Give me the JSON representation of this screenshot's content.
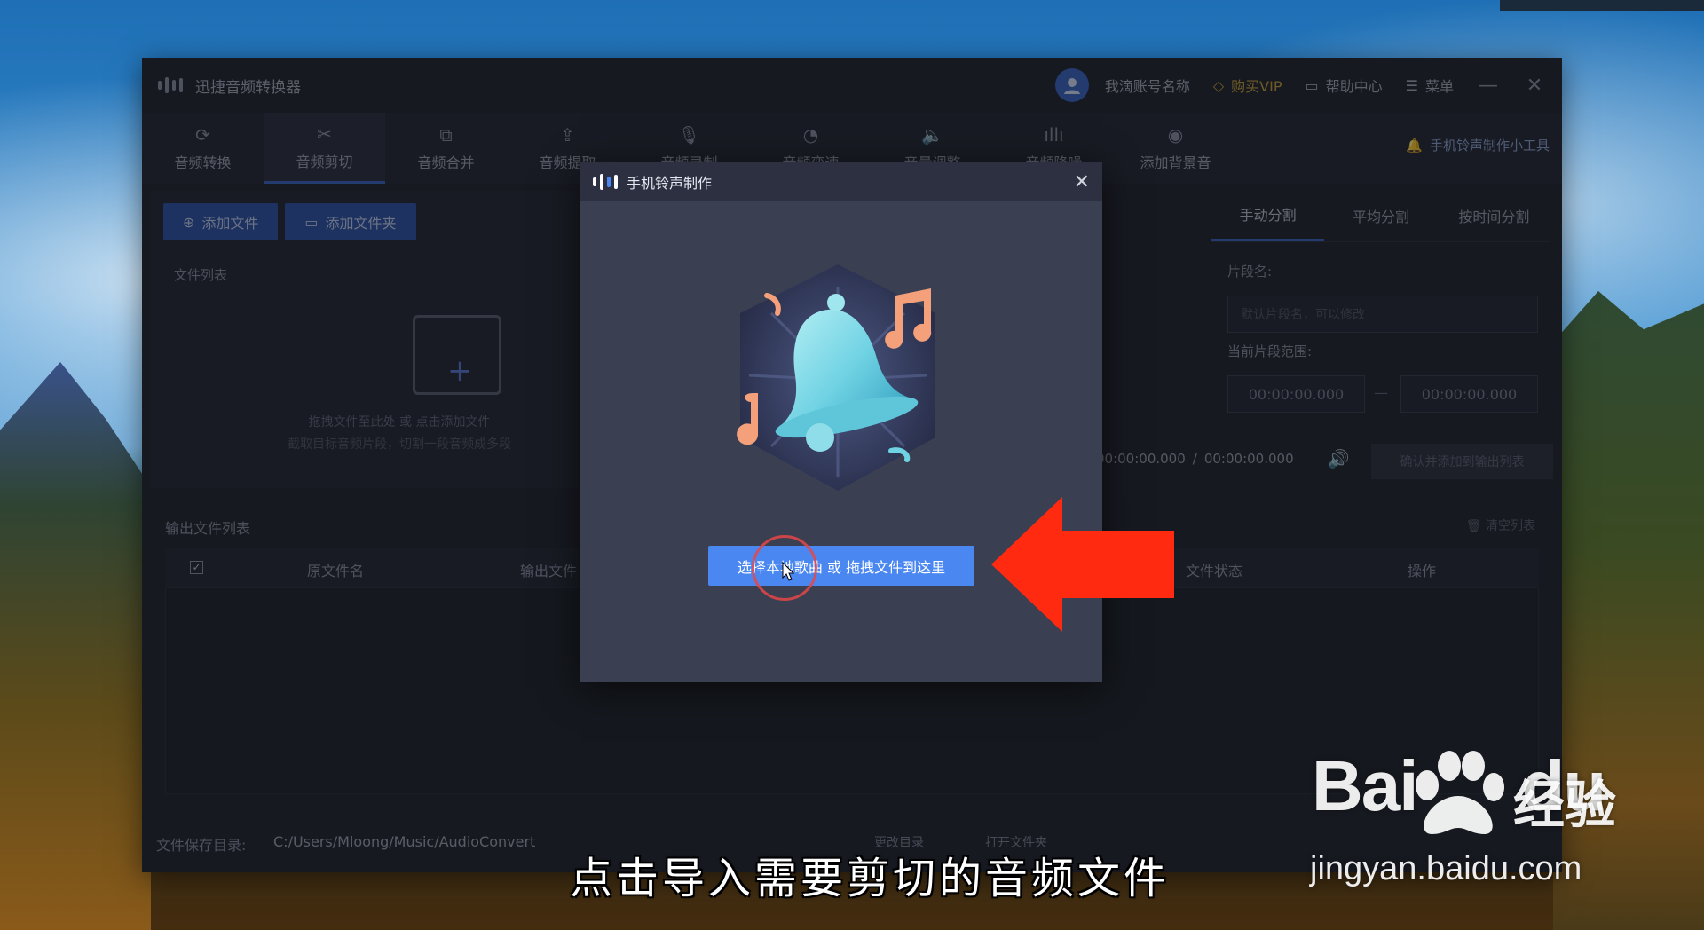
{
  "app": {
    "title": "迅捷音频转换器",
    "account": "我滴账号名称",
    "vip": "购买VIP",
    "help": "帮助中心",
    "menu": "菜单"
  },
  "toolbar": {
    "tools": [
      {
        "label": "音频转换",
        "icon": "refresh-icon"
      },
      {
        "label": "音频剪切",
        "icon": "scissors-icon"
      },
      {
        "label": "音频合并",
        "icon": "merge-icon"
      },
      {
        "label": "音频提取",
        "icon": "upload-icon"
      },
      {
        "label": "音频录制",
        "icon": "mic-icon"
      },
      {
        "label": "音频变速",
        "icon": "speed-icon"
      },
      {
        "label": "音量调整",
        "icon": "volume-icon"
      },
      {
        "label": "音频降噪",
        "icon": "waveform-icon"
      },
      {
        "label": "添加背景音",
        "icon": "music-disc-icon"
      }
    ],
    "active_index": 1,
    "ringtone_tool": "手机铃声制作小工具"
  },
  "left": {
    "add_file": "添加文件",
    "add_folder": "添加文件夹",
    "file_list_label": "文件列表",
    "empty_hint1": "拖拽文件至此处 或 点击添加文件",
    "empty_hint2": "截取目标音频片段，切割一段音频成多段"
  },
  "right": {
    "tabs": [
      "手动分割",
      "平均分割",
      "按时间分割"
    ],
    "segment_name_label": "片段名:",
    "segment_name_placeholder": "默认片段名，可以修改",
    "range_label": "当前片段范围:",
    "start_time": "00:00:00.000",
    "range_dash": "—",
    "end_time": "00:00:00.000",
    "current_time": "00:00:00.000",
    "time_separator": "/",
    "total_time": "00:00:00.000",
    "confirm": "确认并添加到输出列表"
  },
  "output": {
    "label": "输出文件列表",
    "clear": "清空列表",
    "columns": [
      "原文件名",
      "输出文件",
      "文件状态",
      "操作"
    ]
  },
  "footer": {
    "save_dir_label": "文件保存目录:",
    "save_dir": "C:/Users/Mloong/Music/AudioConvert",
    "change_dir": "更改目录",
    "open_folder": "打开文件夹"
  },
  "modal": {
    "title": "手机铃声制作",
    "select_button": "选择本地歌曲 或 拖拽文件到这里"
  },
  "overlay": {
    "subtitle": "点击导入需要剪切的音频文件",
    "watermark_logo_a": "Bai",
    "watermark_logo_b": "du",
    "watermark_cn": "经验",
    "watermark_url": "jingyan.baidu.com"
  },
  "colors": {
    "accent": "#3a66c4",
    "modal_button": "#4a87f0",
    "arrow": "#ff2a10",
    "vip": "#c8a23a"
  }
}
